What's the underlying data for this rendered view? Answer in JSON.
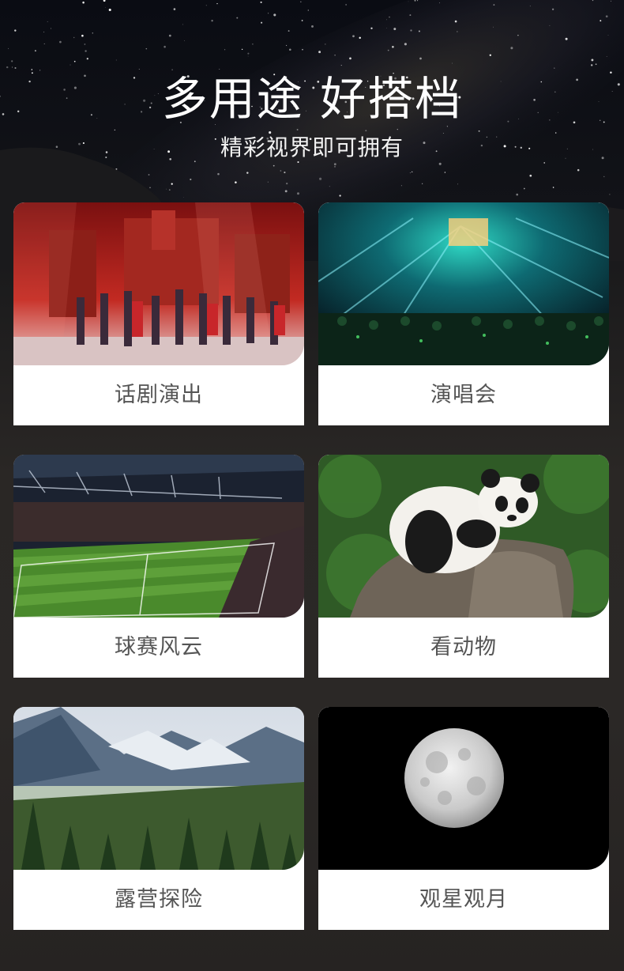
{
  "header": {
    "title": "多用途 好搭档",
    "subtitle": "精彩视界即可拥有"
  },
  "cards": [
    {
      "label": "话剧演出",
      "image": "theater-stage-photo"
    },
    {
      "label": "演唱会",
      "image": "concert-crowd-photo"
    },
    {
      "label": "球赛风云",
      "image": "football-stadium-photo"
    },
    {
      "label": "看动物",
      "image": "panda-photo"
    },
    {
      "label": "露营探险",
      "image": "mountain-forest-photo"
    },
    {
      "label": "观星观月",
      "image": "full-moon-photo"
    }
  ],
  "colors": {
    "card_bg": "#ffffff",
    "label_text": "#555555",
    "headline_text": "#ffffff"
  }
}
